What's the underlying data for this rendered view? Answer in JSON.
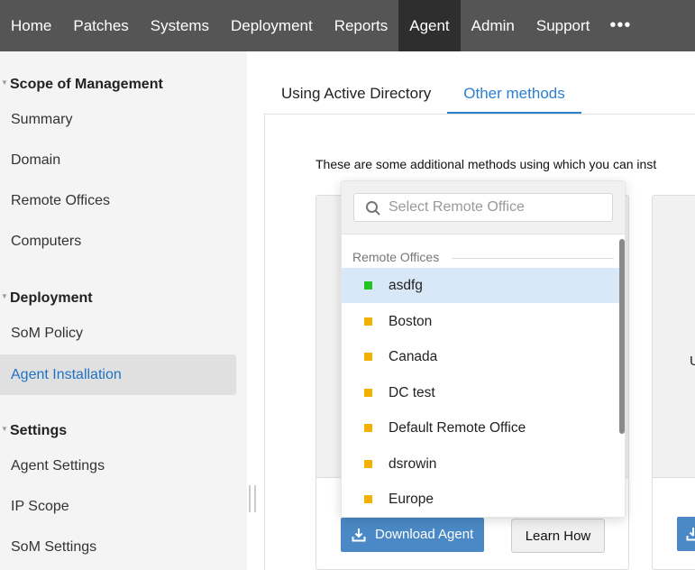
{
  "nav": {
    "items": [
      "Home",
      "Patches",
      "Systems",
      "Deployment",
      "Reports",
      "Agent",
      "Admin",
      "Support"
    ],
    "active": "Agent",
    "more": "•••"
  },
  "sidebar": {
    "sections": [
      {
        "title": "Scope of Management",
        "items": [
          "Summary",
          "Domain",
          "Remote Offices",
          "Computers"
        ]
      },
      {
        "title": "Deployment",
        "items": [
          "SoM Policy",
          "Agent Installation"
        ]
      },
      {
        "title": "Settings",
        "items": [
          "Agent Settings",
          "IP Scope",
          "SoM Settings"
        ]
      }
    ],
    "active": "Agent Installation"
  },
  "tabs": [
    {
      "label": "Using Active Directory"
    },
    {
      "label": "Other methods"
    }
  ],
  "intro": "These are some additional methods using which you can inst",
  "right_card_text": "U",
  "buttons": {
    "download": "Download Agent",
    "learn": "Learn How"
  },
  "dropdown": {
    "placeholder": "Select Remote Office",
    "group": "Remote Offices",
    "options": [
      {
        "label": "asdfg",
        "color": "#22c422"
      },
      {
        "label": "Boston",
        "color": "#f2b100"
      },
      {
        "label": "Canada",
        "color": "#f2b100"
      },
      {
        "label": "DC test",
        "color": "#f2b100"
      },
      {
        "label": "Default Remote Office",
        "color": "#f2b100"
      },
      {
        "label": "dsrowin",
        "color": "#f2b100"
      },
      {
        "label": "Europe",
        "color": "#f2b100"
      }
    ]
  }
}
